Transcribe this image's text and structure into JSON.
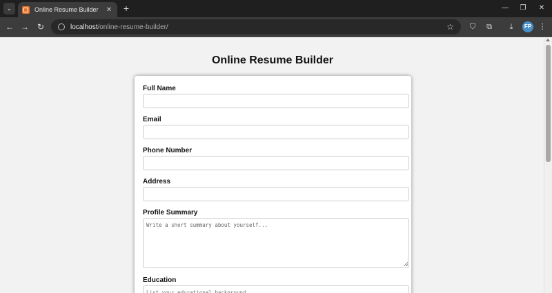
{
  "browser": {
    "tab_title": "Online Resume Builder",
    "url_host": "localhost",
    "url_path": "/online-resume-builder/",
    "new_tab_label": "+",
    "profile_initials": "FP"
  },
  "page": {
    "title": "Online Resume Builder"
  },
  "form": {
    "full_name": {
      "label": "Full Name",
      "value": "",
      "placeholder": ""
    },
    "email": {
      "label": "Email",
      "value": "",
      "placeholder": ""
    },
    "phone": {
      "label": "Phone Number",
      "value": "",
      "placeholder": ""
    },
    "address": {
      "label": "Address",
      "value": "",
      "placeholder": ""
    },
    "summary": {
      "label": "Profile Summary",
      "placeholder": "Write a short summary about yourself..."
    },
    "education": {
      "label": "Education",
      "placeholder": "List your educational background"
    }
  },
  "colors": {
    "chrome_dark": "#1f1f1f",
    "toolbar": "#3c3c3c",
    "page_bg": "#f2f2f2",
    "favicon": "#e8712a"
  }
}
